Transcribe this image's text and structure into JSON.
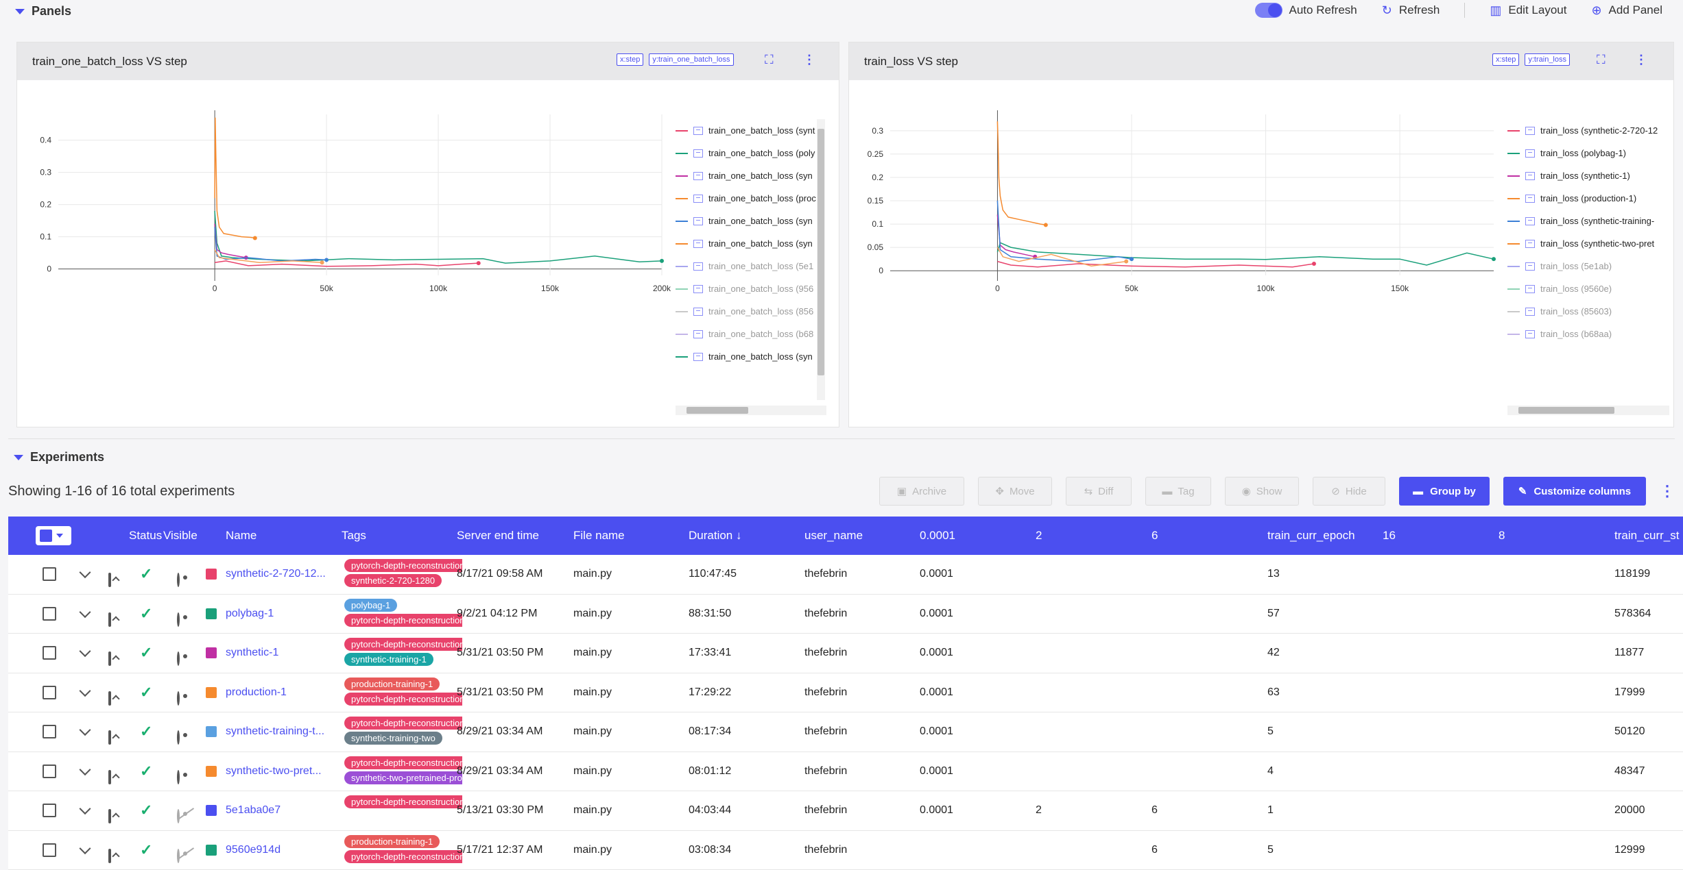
{
  "header": {
    "panels_title": "Panels",
    "auto_refresh": "Auto Refresh",
    "refresh": "Refresh",
    "edit_layout": "Edit Layout",
    "add_panel": "Add Panel"
  },
  "panels": [
    {
      "title": "train_one_batch_loss VS step",
      "x_chip": "x:step",
      "y_chip": "y:train_one_batch_loss",
      "legend": [
        {
          "label": "train_one_batch_loss (synt",
          "color": "#e8426b",
          "dim": false
        },
        {
          "label": "train_one_batch_loss (poly",
          "color": "#1aa07a",
          "dim": false
        },
        {
          "label": "train_one_batch_loss (syn",
          "color": "#c02fa3",
          "dim": false
        },
        {
          "label": "train_one_batch_loss (proc",
          "color": "#f58a2e",
          "dim": false
        },
        {
          "label": "train_one_batch_loss (syn",
          "color": "#3b7fd6",
          "dim": false
        },
        {
          "label": "train_one_batch_loss (syn",
          "color": "#f58a2e",
          "dim": false
        },
        {
          "label": "train_one_batch_loss (5e1",
          "color": "#a8a6ef",
          "dim": true
        },
        {
          "label": "train_one_batch_loss (956",
          "color": "#8fd3b5",
          "dim": true
        },
        {
          "label": "train_one_batch_loss (856",
          "color": "#c9c9c9",
          "dim": true
        },
        {
          "label": "train_one_batch_loss (b68",
          "color": "#c4b6e8",
          "dim": true
        },
        {
          "label": "train_one_batch_loss (syn",
          "color": "#1aa07a",
          "dim": false
        }
      ]
    },
    {
      "title": "train_loss VS step",
      "x_chip": "x:step",
      "y_chip": "y:train_loss",
      "legend": [
        {
          "label": "train_loss (synthetic-2-720-12",
          "color": "#e8426b",
          "dim": false
        },
        {
          "label": "train_loss (polybag-1)",
          "color": "#1aa07a",
          "dim": false
        },
        {
          "label": "train_loss (synthetic-1)",
          "color": "#c02fa3",
          "dim": false
        },
        {
          "label": "train_loss (production-1)",
          "color": "#f58a2e",
          "dim": false
        },
        {
          "label": "train_loss (synthetic-training-",
          "color": "#3b7fd6",
          "dim": false
        },
        {
          "label": "train_loss (synthetic-two-pret",
          "color": "#f58a2e",
          "dim": false
        },
        {
          "label": "train_loss (5e1ab)",
          "color": "#a8a6ef",
          "dim": true
        },
        {
          "label": "train_loss (9560e)",
          "color": "#8fd3b5",
          "dim": true
        },
        {
          "label": "train_loss (85603)",
          "color": "#c9c9c9",
          "dim": true
        },
        {
          "label": "train_loss (b68aa)",
          "color": "#c4b6e8",
          "dim": true
        }
      ]
    }
  ],
  "chart_data": [
    {
      "type": "line",
      "title": "train_one_batch_loss VS step",
      "xlim": [
        -70000,
        200000
      ],
      "ylim": [
        -0.02,
        0.48
      ],
      "x_ticks": [
        "0",
        "50k",
        "100k",
        "150k",
        "200k"
      ],
      "x_tick_values": [
        0,
        50000,
        100000,
        150000,
        200000
      ],
      "y_ticks": [
        "0",
        "0.1",
        "0.2",
        "0.3",
        "0.4"
      ],
      "y_tick_values": [
        0,
        0.1,
        0.2,
        0.3,
        0.4
      ],
      "series": [
        {
          "color": "#1aa07a",
          "x": [
            0,
            1000,
            3000,
            8000,
            20000,
            40000,
            60000,
            80000,
            100000,
            120000,
            130000,
            150000,
            170000,
            190000,
            200000
          ],
          "y": [
            0.18,
            0.08,
            0.04,
            0.035,
            0.03,
            0.025,
            0.032,
            0.028,
            0.03,
            0.032,
            0.018,
            0.025,
            0.04,
            0.022,
            0.025
          ]
        },
        {
          "color": "#e8426b",
          "x": [
            0,
            5000,
            15000,
            30000,
            50000,
            70000,
            90000,
            100000,
            110000,
            118000
          ],
          "y": [
            0.02,
            0.025,
            0.01,
            0.015,
            0.008,
            0.01,
            0.015,
            0.01,
            0.015,
            0.018
          ]
        },
        {
          "color": "#f58a2e",
          "x": [
            0,
            200,
            500,
            1000,
            2000,
            4000,
            8000,
            12000,
            16000,
            18000
          ],
          "y": [
            0.22,
            0.47,
            0.35,
            0.18,
            0.13,
            0.11,
            0.105,
            0.1,
            0.098,
            0.096
          ]
        },
        {
          "color": "#c02fa3",
          "x": [
            0,
            1000,
            3000,
            6000,
            10000,
            14000
          ],
          "y": [
            0.14,
            0.06,
            0.05,
            0.045,
            0.04,
            0.035
          ]
        },
        {
          "color": "#3b7fd6",
          "x": [
            0,
            1000,
            5000,
            15000,
            30000,
            45000,
            50000
          ],
          "y": [
            0.13,
            0.04,
            0.03,
            0.035,
            0.025,
            0.03,
            0.028
          ]
        },
        {
          "color": "#f5a05a",
          "x": [
            0,
            2000,
            8000,
            20000,
            35000,
            48000
          ],
          "y": [
            0.06,
            0.035,
            0.03,
            0.02,
            0.025,
            0.02
          ]
        }
      ]
    },
    {
      "type": "line",
      "title": "train_loss VS step",
      "xlim": [
        -40000,
        185000
      ],
      "ylim": [
        -0.01,
        0.335
      ],
      "x_ticks": [
        "0",
        "50k",
        "100k",
        "150k"
      ],
      "x_tick_values": [
        0,
        50000,
        100000,
        150000
      ],
      "y_ticks": [
        "0",
        "0.05",
        "0.1",
        "0.15",
        "0.2",
        "0.25",
        "0.3"
      ],
      "y_tick_values": [
        0,
        0.05,
        0.1,
        0.15,
        0.2,
        0.25,
        0.3
      ],
      "series": [
        {
          "color": "#1aa07a",
          "x": [
            0,
            1000,
            5000,
            15000,
            30000,
            50000,
            70000,
            90000,
            100000,
            120000,
            140000,
            150000,
            160000,
            175000,
            185000
          ],
          "y": [
            0.04,
            0.06,
            0.05,
            0.04,
            0.035,
            0.028,
            0.025,
            0.025,
            0.024,
            0.03,
            0.025,
            0.025,
            0.012,
            0.038,
            0.025
          ]
        },
        {
          "color": "#e8426b",
          "x": [
            0,
            5000,
            15000,
            30000,
            50000,
            70000,
            90000,
            110000,
            118000
          ],
          "y": [
            0.02,
            0.012,
            0.008,
            0.015,
            0.01,
            0.008,
            0.012,
            0.008,
            0.015
          ]
        },
        {
          "color": "#f58a2e",
          "x": [
            0,
            200,
            500,
            1000,
            2000,
            4000,
            8000,
            12000,
            16000,
            18000
          ],
          "y": [
            0.32,
            0.28,
            0.2,
            0.16,
            0.13,
            0.115,
            0.11,
            0.105,
            0.1,
            0.098
          ]
        },
        {
          "color": "#c02fa3",
          "x": [
            0,
            1000,
            3000,
            6000,
            10000,
            14000
          ],
          "y": [
            0.12,
            0.055,
            0.045,
            0.04,
            0.035,
            0.03
          ]
        },
        {
          "color": "#3b7fd6",
          "x": [
            0,
            1000,
            5000,
            15000,
            30000,
            45000,
            50000
          ],
          "y": [
            0.15,
            0.045,
            0.03,
            0.025,
            0.02,
            0.03,
            0.025
          ]
        },
        {
          "color": "#f5a05a",
          "x": [
            0,
            2000,
            8000,
            20000,
            35000,
            48000
          ],
          "y": [
            0.05,
            0.03,
            0.02,
            0.035,
            0.01,
            0.02
          ]
        }
      ]
    }
  ],
  "experiments": {
    "section_title": "Experiments",
    "showing": "Showing 1-16 of 16 total experiments",
    "buttons": {
      "archive": "Archive",
      "move": "Move",
      "diff": "Diff",
      "tag": "Tag",
      "show": "Show",
      "hide": "Hide",
      "group_by": "Group by",
      "customize": "Customize columns"
    },
    "columns": {
      "status": "Status",
      "visible": "Visible",
      "name": "Name",
      "tags": "Tags",
      "server_end_time": "Server end time",
      "file_name": "File name",
      "duration": "Duration",
      "user_name": "user_name",
      "c1": "0.0001",
      "c2": "2",
      "c3": "6",
      "train_curr_epoch": "train_curr_epoch",
      "c16": "16",
      "c8": "8",
      "train_curr_step": "train_curr_st"
    },
    "rows": [
      {
        "color": "#e8426b",
        "name": "synthetic-2-720-12...",
        "hidden": false,
        "tags": [
          {
            "t": "pytorch-depth-reconstruction",
            "c": "#e8426b"
          },
          {
            "t": "synthetic-2-720-1280",
            "c": "#e8426b"
          }
        ],
        "end": "8/17/21 09:58 AM",
        "file": "main.py",
        "duration": "110:47:45",
        "user": "thefebrin",
        "v1": "0.0001",
        "v2": "",
        "v3": "",
        "epoch": "13",
        "step": "118199"
      },
      {
        "color": "#1aa07a",
        "name": "polybag-1",
        "hidden": false,
        "tags": [
          {
            "t": "polybag-1",
            "c": "#5aa0e0"
          },
          {
            "t": "pytorch-depth-reconstruction",
            "c": "#e8426b"
          }
        ],
        "end": "9/2/21 04:12 PM",
        "file": "main.py",
        "duration": "88:31:50",
        "user": "thefebrin",
        "v1": "0.0001",
        "v2": "",
        "v3": "",
        "epoch": "57",
        "step": "578364"
      },
      {
        "color": "#c02fa3",
        "name": "synthetic-1",
        "hidden": false,
        "tags": [
          {
            "t": "pytorch-depth-reconstruction",
            "c": "#e8426b"
          },
          {
            "t": "synthetic-training-1",
            "c": "#1aa5a5"
          }
        ],
        "end": "5/31/21 03:50 PM",
        "file": "main.py",
        "duration": "17:33:41",
        "user": "thefebrin",
        "v1": "0.0001",
        "v2": "",
        "v3": "",
        "epoch": "42",
        "step": "11877"
      },
      {
        "color": "#f58a2e",
        "name": "production-1",
        "hidden": false,
        "tags": [
          {
            "t": "production-training-1",
            "c": "#e85a5a"
          },
          {
            "t": "pytorch-depth-reconstruction",
            "c": "#e8426b"
          }
        ],
        "end": "5/31/21 03:50 PM",
        "file": "main.py",
        "duration": "17:29:22",
        "user": "thefebrin",
        "v1": "0.0001",
        "v2": "",
        "v3": "",
        "epoch": "63",
        "step": "17999"
      },
      {
        "color": "#5aa0e0",
        "name": "synthetic-training-t...",
        "hidden": false,
        "tags": [
          {
            "t": "pytorch-depth-reconstruction",
            "c": "#e8426b"
          },
          {
            "t": "synthetic-training-two",
            "c": "#6b7f8a"
          }
        ],
        "end": "8/29/21 03:34 AM",
        "file": "main.py",
        "duration": "08:17:34",
        "user": "thefebrin",
        "v1": "0.0001",
        "v2": "",
        "v3": "",
        "epoch": "5",
        "step": "50120"
      },
      {
        "color": "#f58a2e",
        "name": "synthetic-two-pret...",
        "hidden": false,
        "tags": [
          {
            "t": "pytorch-depth-reconstruction",
            "c": "#e8426b"
          },
          {
            "t": "synthetic-two-pretrained-production",
            "c": "#9b4fd6"
          }
        ],
        "end": "8/29/21 03:34 AM",
        "file": "main.py",
        "duration": "08:01:12",
        "user": "thefebrin",
        "v1": "0.0001",
        "v2": "",
        "v3": "",
        "epoch": "4",
        "step": "48347"
      },
      {
        "color": "#4b4ff0",
        "name": "5e1aba0e7",
        "hidden": true,
        "tags": [
          {
            "t": "pytorch-depth-reconstruction",
            "c": "#e8426b"
          }
        ],
        "end": "5/13/21 03:30 PM",
        "file": "main.py",
        "duration": "04:03:44",
        "user": "thefebrin",
        "v1": "0.0001",
        "v2": "2",
        "v3": "6",
        "epoch": "1",
        "step": "20000"
      },
      {
        "color": "#1aa07a",
        "name": "9560e914d",
        "hidden": true,
        "tags": [
          {
            "t": "production-training-1",
            "c": "#e85a5a"
          },
          {
            "t": "pytorch-depth-reconstruction",
            "c": "#e8426b"
          }
        ],
        "end": "5/17/21 12:37 AM",
        "file": "main.py",
        "duration": "03:08:34",
        "user": "thefebrin",
        "v1": "",
        "v2": "",
        "v3": "6",
        "epoch": "5",
        "step": "12999"
      }
    ]
  }
}
